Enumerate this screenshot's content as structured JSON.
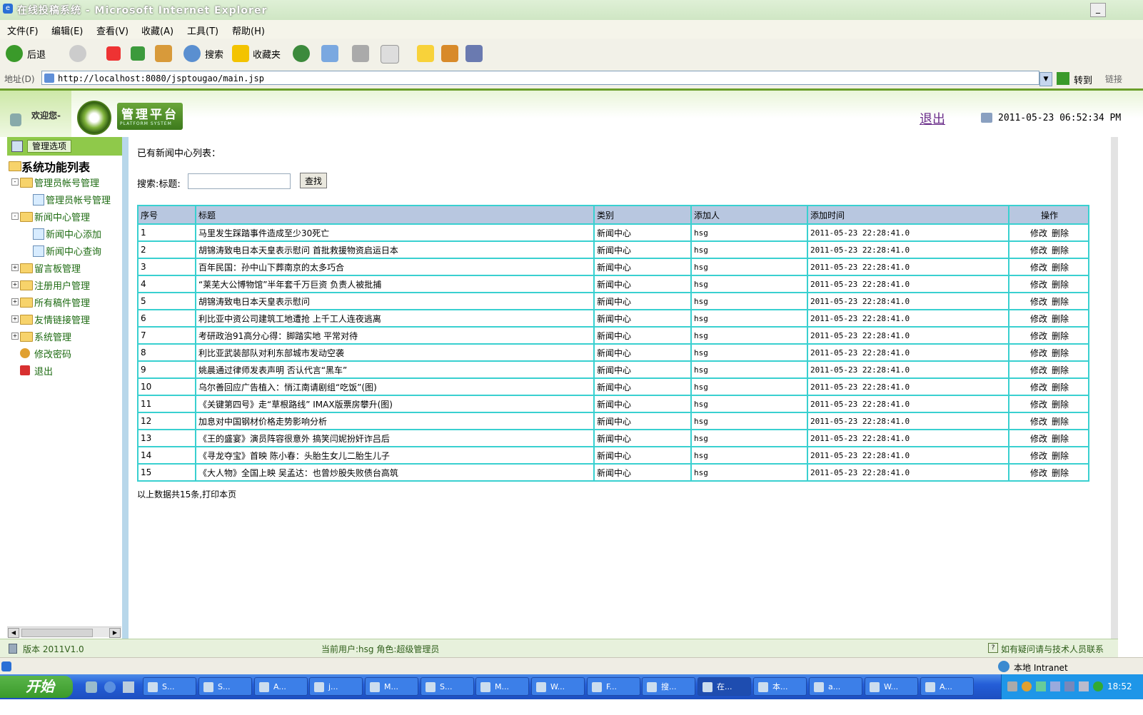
{
  "window": {
    "title": "在线投稿系统 - Microsoft Internet Explorer"
  },
  "menu": [
    "文件(F)",
    "编辑(E)",
    "查看(V)",
    "收藏(A)",
    "工具(T)",
    "帮助(H)"
  ],
  "toolbar": {
    "back": "后退",
    "search": "搜索",
    "favorites": "收藏夹",
    "go": "转到",
    "links": "链接"
  },
  "address": {
    "label": "地址(D)",
    "url": "http://localhost:8080/jsptougao/main.jsp"
  },
  "header": {
    "welcome": "欢迎您-",
    "logo_title": "管理平台",
    "logo_sub": "PLATFORM SYSTEM",
    "logout": "退出",
    "datetime": "2011-05-23 06:52:34 PM"
  },
  "sidebar": {
    "head_button": "管理选项",
    "root": "系统功能列表",
    "items": [
      {
        "label": "管理员帐号管理",
        "level": 1
      },
      {
        "label": "管理员帐号管理",
        "level": 2
      },
      {
        "label": "新闻中心管理",
        "level": 1
      },
      {
        "label": "新闻中心添加",
        "level": 2
      },
      {
        "label": "新闻中心查询",
        "level": 2
      },
      {
        "label": "留言板管理",
        "level": 1
      },
      {
        "label": "注册用户管理",
        "level": 1
      },
      {
        "label": "所有稿件管理",
        "level": 1
      },
      {
        "label": "友情链接管理",
        "level": 1
      },
      {
        "label": "系统管理",
        "level": 1
      },
      {
        "label": "修改密码",
        "level": 1
      },
      {
        "label": "退出",
        "level": 1
      }
    ]
  },
  "main": {
    "list_title": "已有新闻中心列表：",
    "search_label": "搜索:标题:",
    "search_value": "",
    "search_button": "查找",
    "columns": [
      "序号",
      "标题",
      "类别",
      "添加人",
      "添加时间",
      "操作"
    ],
    "rows": [
      {
        "no": "1",
        "title": "马里发生踩踏事件造成至少30死亡",
        "category": "新闻中心",
        "user": "hsg",
        "time": "2011-05-23 22:28:41.0"
      },
      {
        "no": "2",
        "title": "胡锦涛致电日本天皇表示慰问 首批救援物资启运日本",
        "category": "新闻中心",
        "user": "hsg",
        "time": "2011-05-23 22:28:41.0"
      },
      {
        "no": "3",
        "title": "百年民国：孙中山下葬南京的太多巧合",
        "category": "新闻中心",
        "user": "hsg",
        "time": "2011-05-23 22:28:41.0"
      },
      {
        "no": "4",
        "title": "“莱芜大公博物馆”半年套千万巨资 负责人被批捕",
        "category": "新闻中心",
        "user": "hsg",
        "time": "2011-05-23 22:28:41.0"
      },
      {
        "no": "5",
        "title": "胡锦涛致电日本天皇表示慰问",
        "category": "新闻中心",
        "user": "hsg",
        "time": "2011-05-23 22:28:41.0"
      },
      {
        "no": "6",
        "title": "利比亚中资公司建筑工地遭抢 上千工人连夜逃离",
        "category": "新闻中心",
        "user": "hsg",
        "time": "2011-05-23 22:28:41.0"
      },
      {
        "no": "7",
        "title": "考研政治91高分心得：脚踏实地 平常对待",
        "category": "新闻中心",
        "user": "hsg",
        "time": "2011-05-23 22:28:41.0"
      },
      {
        "no": "8",
        "title": "利比亚武装部队对利东部城市发动空袭",
        "category": "新闻中心",
        "user": "hsg",
        "time": "2011-05-23 22:28:41.0"
      },
      {
        "no": "9",
        "title": "姚晨通过律师发表声明 否认代言“黑车”",
        "category": "新闻中心",
        "user": "hsg",
        "time": "2011-05-23 22:28:41.0"
      },
      {
        "no": "10",
        "title": "乌尔善回应广告植入：悄江南请剧组“吃饭”(图)",
        "category": "新闻中心",
        "user": "hsg",
        "time": "2011-05-23 22:28:41.0"
      },
      {
        "no": "11",
        "title": "《关键第四号》走“草根路线” IMAX版票房攀升(图)",
        "category": "新闻中心",
        "user": "hsg",
        "time": "2011-05-23 22:28:41.0"
      },
      {
        "no": "12",
        "title": "加息对中国钢材价格走势影响分析",
        "category": "新闻中心",
        "user": "hsg",
        "time": "2011-05-23 22:28:41.0"
      },
      {
        "no": "13",
        "title": "《王的盛宴》演员阵容很意外 搞笑闫妮扮奸诈吕后",
        "category": "新闻中心",
        "user": "hsg",
        "time": "2011-05-23 22:28:41.0"
      },
      {
        "no": "14",
        "title": "《寻龙夺宝》首映 陈小春：头胎生女儿二胎生儿子",
        "category": "新闻中心",
        "user": "hsg",
        "time": "2011-05-23 22:28:41.0"
      },
      {
        "no": "15",
        "title": "《大人物》全国上映 吴孟达：也曾炒股失败债台高筑",
        "category": "新闻中心",
        "user": "hsg",
        "time": "2011-05-23 22:28:41.0"
      }
    ],
    "edit_label": "修改",
    "delete_label": "删除",
    "summary": "以上数据共15条,打印本页"
  },
  "footer": {
    "version": "版本 2011V1.0",
    "current_user": "当前用户:hsg  角色:超级管理员",
    "help": "如有疑问请与技术人员联系"
  },
  "statusbar": {
    "zone": "本地 Intranet"
  },
  "taskbar": {
    "start": "开始",
    "tasks": [
      "S...",
      "S...",
      "A...",
      "j...",
      "M...",
      "S...",
      "M...",
      "W...",
      "F...",
      "搜...",
      "在...",
      "本...",
      "a...",
      "W...",
      "A..."
    ],
    "time": "18:52"
  },
  "colors": {
    "accent_green": "#8fc94a",
    "table_border": "#39d0d0",
    "table_header": "#b8c7e0"
  }
}
